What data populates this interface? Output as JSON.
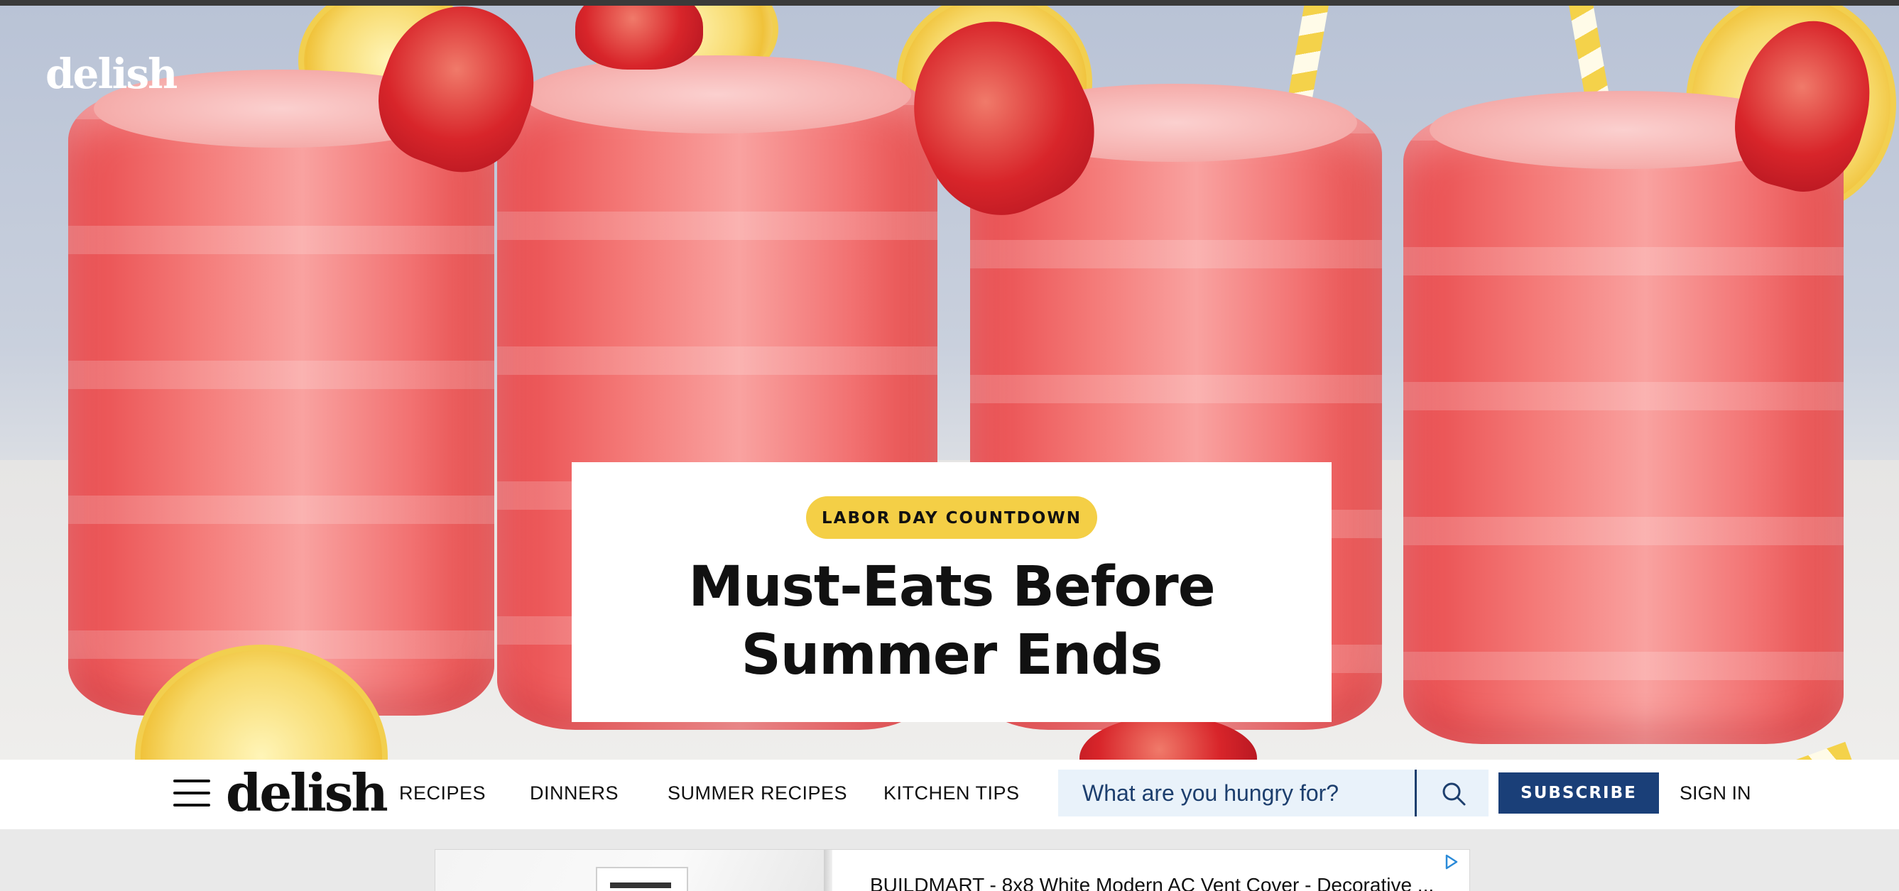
{
  "hero": {
    "logo": "delish",
    "badge": "LABOR DAY COUNTDOWN",
    "title_line1": "Must-Eats Before",
    "title_line2": "Summer Ends"
  },
  "nav": {
    "logo": "delish",
    "links": [
      "RECIPES",
      "DINNERS",
      "SUMMER RECIPES",
      "KITCHEN TIPS"
    ],
    "search_placeholder": "What are you hungry for?",
    "subscribe": "SUBSCRIBE",
    "signin": "SIGN IN"
  },
  "ad": {
    "text": "BUILDMART - 8x8 White Modern AC Vent Cover - Decorative ..."
  },
  "colors": {
    "badge": "#f4cf46",
    "subscribe": "#1a3f78",
    "search_bg": "#e9f2fa"
  }
}
